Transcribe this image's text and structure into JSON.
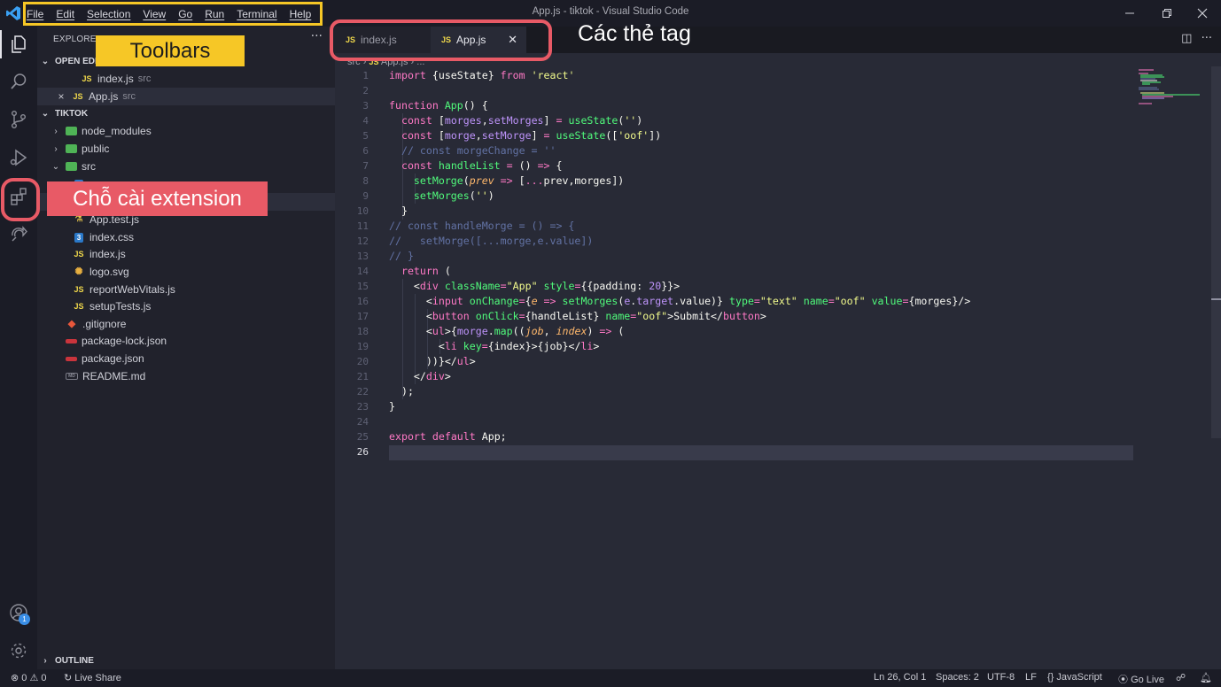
{
  "window": {
    "title": "App.js - tiktok - Visual Studio Code",
    "controls": [
      "minimize-icon",
      "restore-icon",
      "close-icon"
    ]
  },
  "menu": [
    "File",
    "Edit",
    "Selection",
    "View",
    "Go",
    "Run",
    "Terminal",
    "Help"
  ],
  "activity_bar": {
    "items": [
      "explorer-icon",
      "search-icon",
      "source-control-icon",
      "run-debug-icon",
      "extensions-icon",
      "live-share-icon"
    ],
    "bottom": [
      "account-icon",
      "manage-gear-icon"
    ],
    "account_badge": "1"
  },
  "sidebar": {
    "header": "EXPLORER",
    "open_editors_label": "OPEN EDITORS",
    "open_editors": [
      {
        "name": "index.js",
        "desc": "src"
      },
      {
        "name": "App.js",
        "desc": "src"
      }
    ],
    "workspace_label": "TIKTOK",
    "tree": [
      {
        "name": "node_modules"
      },
      {
        "name": "public"
      },
      {
        "name": "src"
      },
      {
        "name": "App.test.js"
      },
      {
        "name": "index.css"
      },
      {
        "name": "index.js"
      },
      {
        "name": "logo.svg"
      },
      {
        "name": "reportWebVitals.js"
      },
      {
        "name": "setupTests.js"
      },
      {
        "name": ".gitignore"
      },
      {
        "name": "package-lock.json"
      },
      {
        "name": "package.json"
      },
      {
        "name": "README.md"
      }
    ],
    "outline_label": "OUTLINE"
  },
  "tabs": [
    {
      "icon": "JS",
      "label": "index.js",
      "active": false
    },
    {
      "icon": "JS",
      "label": "App.js",
      "active": true
    }
  ],
  "breadcrumb": {
    "folder": "src",
    "icon": "JS",
    "file": "App.js",
    "rest": "..."
  },
  "editor": {
    "line_numbers": [
      "1",
      "2",
      "3",
      "4",
      "5",
      "6",
      "7",
      "8",
      "9",
      "10",
      "11",
      "12",
      "13",
      "14",
      "15",
      "16",
      "17",
      "18",
      "19",
      "20",
      "21",
      "22",
      "23",
      "24",
      "25",
      "26"
    ],
    "current_line": "26"
  },
  "statusbar": {
    "problems": "0",
    "warnings": "0",
    "live_share": "Live Share",
    "position": "Ln 26, Col 1",
    "spaces": "Spaces: 2",
    "encoding": "UTF-8",
    "eol": "LF",
    "language": "JavaScript",
    "go_live": "Go Live"
  },
  "annotations": {
    "toolbars": "Toolbars",
    "tabs": "Các thẻ tag",
    "extension": "Chỗ cài extension",
    "menu_box_color": "#f6c726",
    "highlight_color": "#e85a66"
  }
}
